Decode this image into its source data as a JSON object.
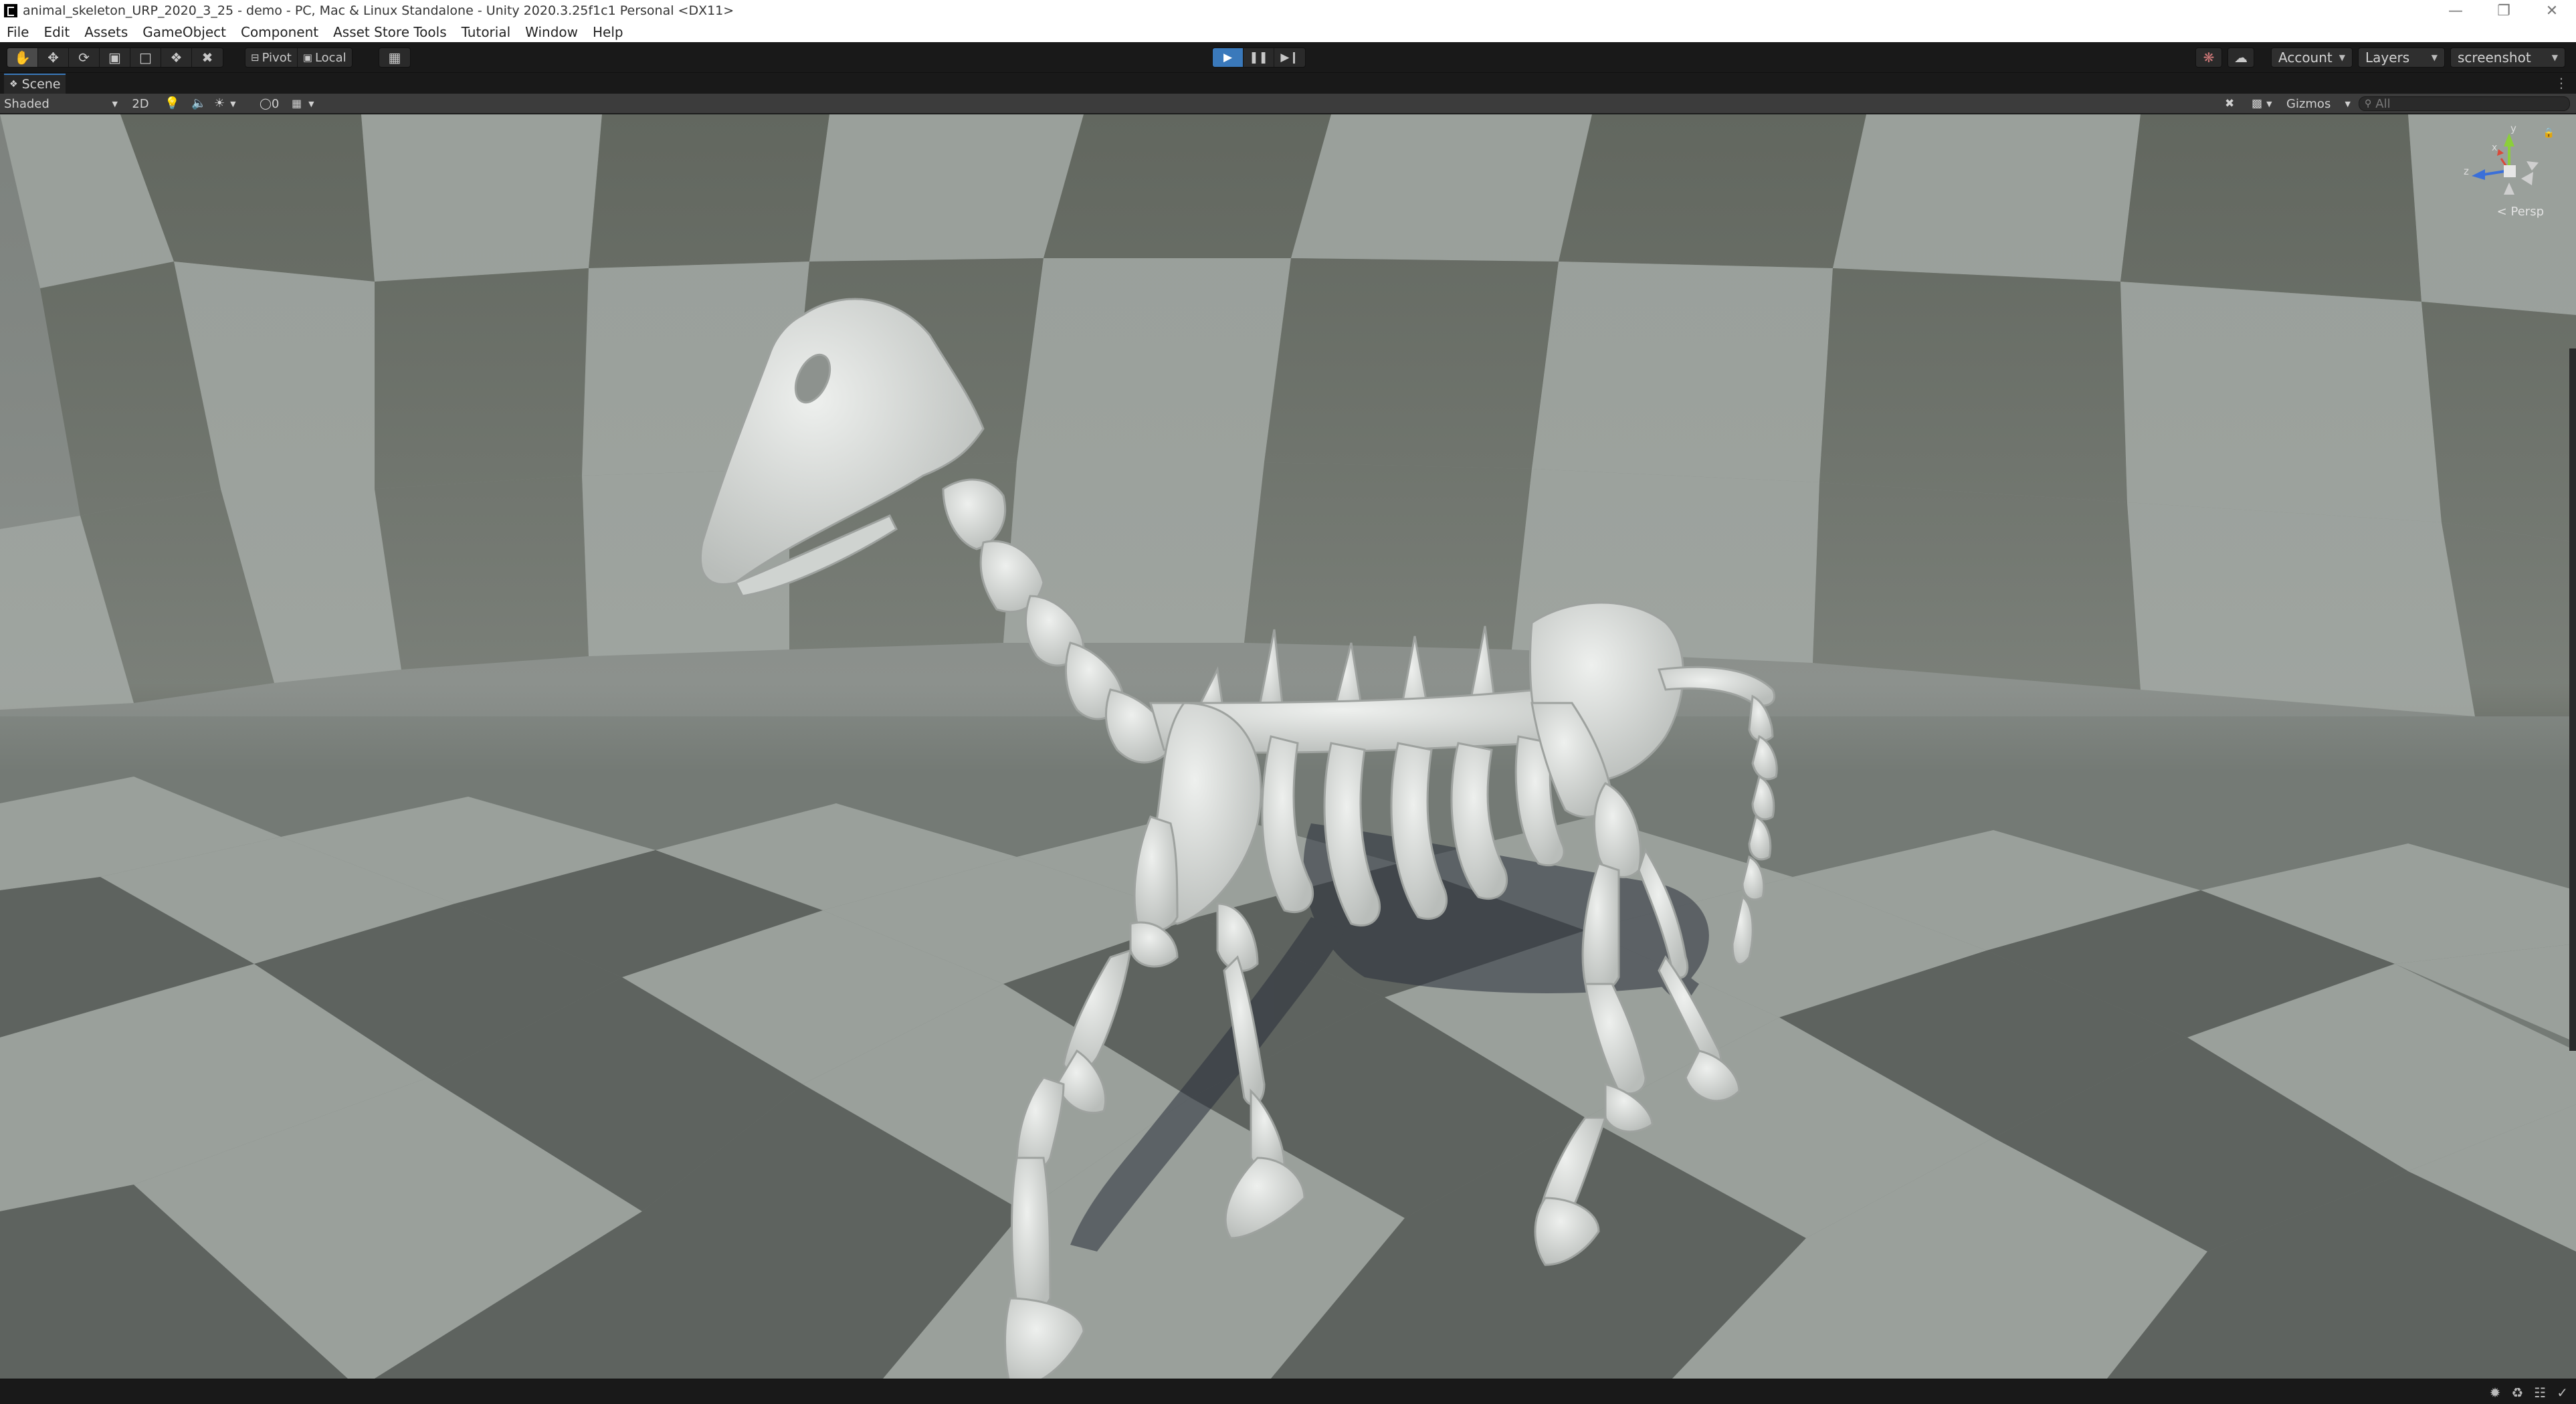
{
  "window": {
    "title": "animal_skeleton_URP_2020_3_25 - demo - PC, Mac & Linux Standalone - Unity 2020.3.25f1c1 Personal <DX11>",
    "controls": [
      "minimize-icon",
      "restore-icon",
      "close-icon"
    ]
  },
  "menu": [
    "File",
    "Edit",
    "Assets",
    "GameObject",
    "Component",
    "Asset Store Tools",
    "Tutorial",
    "Window",
    "Help"
  ],
  "toolbar": {
    "tools": [
      "hand-tool-icon",
      "move-tool-icon",
      "rotate-tool-icon",
      "scale-tool-icon",
      "rect-tool-icon",
      "transform-tool-icon",
      "custom-tool-icon"
    ],
    "pivot_label": "Pivot",
    "local_label": "Local",
    "grid_snap_icon": "grid-icon",
    "play_icons": [
      "play-icon",
      "pause-icon",
      "step-icon"
    ],
    "account_label": "Account",
    "layers_label": "Layers",
    "layout_label": "screenshot"
  },
  "scene_tab": {
    "label": "Scene"
  },
  "scene_toolbar": {
    "draw_mode": "Shaded",
    "toggle_2d": "2D",
    "hidden_count": "0",
    "gizmos_label": "Gizmos",
    "search_placeholder": "All"
  },
  "gizmo": {
    "y_label": "y",
    "x_label": "x",
    "z_label": "z",
    "projection_label": "Persp"
  },
  "colors": {
    "play_accent": "#3a79bb",
    "axis_x": "#d94a3a",
    "axis_y": "#8ccf3a",
    "axis_z": "#3a6fd9",
    "bone": "#d9dcda",
    "floor_light": "#9aa09b",
    "floor_dark": "#5e635f"
  }
}
